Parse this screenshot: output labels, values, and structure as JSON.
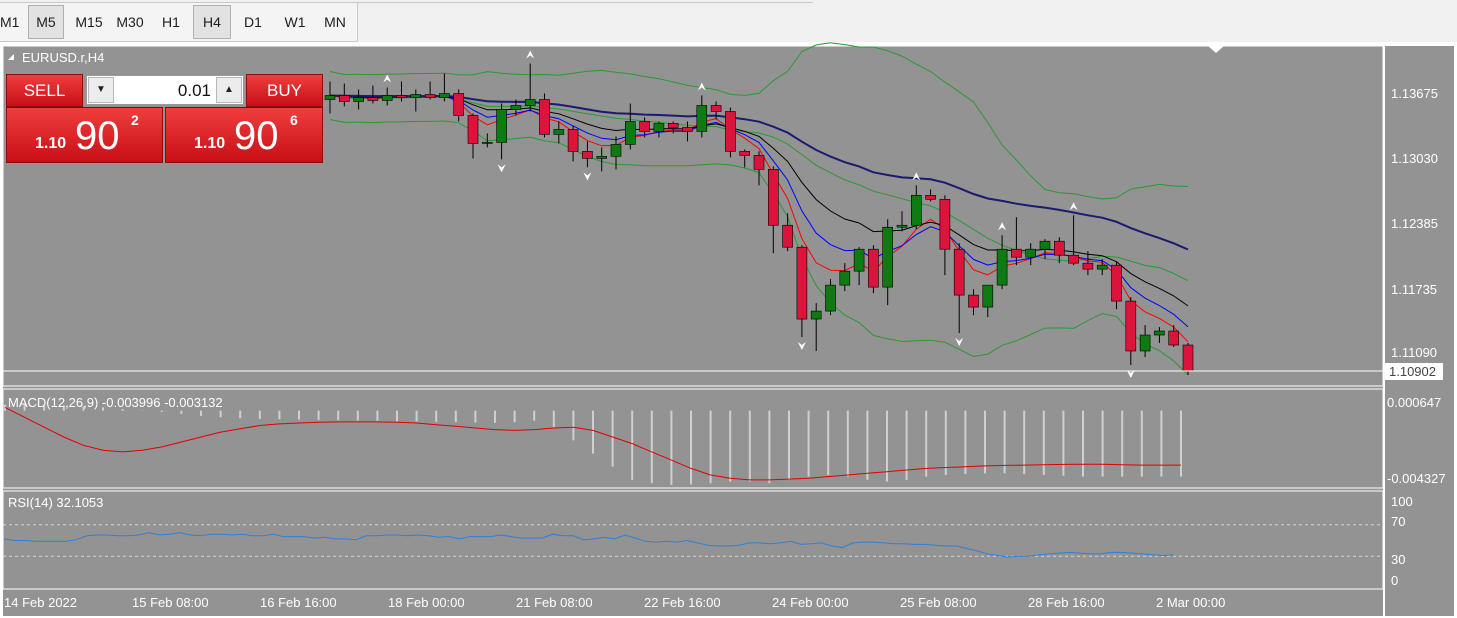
{
  "timeframes": [
    "M1",
    "M5",
    "M15",
    "M30",
    "H1",
    "H4",
    "D1",
    "W1",
    "MN"
  ],
  "active_timeframes": [
    "M5",
    "H4"
  ],
  "chart_title": "EURUSD.r,H4",
  "trade_panel": {
    "sell_label": "SELL",
    "buy_label": "BUY",
    "lot": "0.01",
    "sell_price": {
      "small": "1.10",
      "big": "90",
      "sup": "2"
    },
    "buy_price": {
      "small": "1.10",
      "big": "90",
      "sup": "6"
    }
  },
  "price_axis": {
    "ticks": [
      "1.13675",
      "1.13030",
      "1.12385",
      "1.11735",
      "1.11090"
    ],
    "current": "1.10902"
  },
  "macd": {
    "label": "MACD(12,26,9) -0.003996 -0.003132",
    "ticks": [
      "0.000647",
      "-0.004327"
    ]
  },
  "rsi": {
    "label": "RSI(14) 32.1053",
    "ticks": [
      "100",
      "70",
      "30",
      "0"
    ]
  },
  "time_axis": [
    "14 Feb 2022",
    "15 Feb 08:00",
    "16 Feb 16:00",
    "18 Feb 00:00",
    "21 Feb 08:00",
    "22 Feb 16:00",
    "24 Feb 00:00",
    "25 Feb 08:00",
    "28 Feb 16:00",
    "2 Mar 00:00"
  ],
  "colors": {
    "background": "#939393",
    "bull": "#0d7a12",
    "bear": "#dc143c",
    "ma_fast": "#ff0000",
    "ma_mid": "#0000ff",
    "ma_slow": "#000000",
    "ma_long": "#1a1a6e",
    "bollinger": "#2a9a32",
    "macd_signal": "#e00000",
    "rsi_line": "#2f7fd6"
  },
  "chart_data": {
    "type": "candlestick",
    "symbol": "EURUSD.r",
    "timeframe": "H4",
    "candles": [
      [
        1.1362,
        1.138,
        1.1348,
        1.1366
      ],
      [
        1.1366,
        1.1378,
        1.1355,
        1.136
      ],
      [
        1.136,
        1.1372,
        1.1352,
        1.1364
      ],
      [
        1.1364,
        1.1376,
        1.1358,
        1.1361
      ],
      [
        1.1361,
        1.1374,
        1.1356,
        1.1366
      ],
      [
        1.1366,
        1.138,
        1.136,
        1.1364
      ],
      [
        1.1364,
        1.1372,
        1.135,
        1.1367
      ],
      [
        1.1367,
        1.138,
        1.1362,
        1.1364
      ],
      [
        1.1364,
        1.1388,
        1.136,
        1.1368
      ],
      [
        1.1368,
        1.1372,
        1.134,
        1.1346
      ],
      [
        1.1346,
        1.1348,
        1.1303,
        1.1318
      ],
      [
        1.1318,
        1.1328,
        1.1314,
        1.1319
      ],
      [
        1.1319,
        1.1358,
        1.1302,
        1.1352
      ],
      [
        1.1352,
        1.1362,
        1.1346,
        1.1356
      ],
      [
        1.1356,
        1.1398,
        1.135,
        1.1362
      ],
      [
        1.1362,
        1.1368,
        1.1324,
        1.1327
      ],
      [
        1.1327,
        1.134,
        1.1318,
        1.1332
      ],
      [
        1.1332,
        1.1336,
        1.13,
        1.131
      ],
      [
        1.131,
        1.132,
        1.1294,
        1.1303
      ],
      [
        1.1303,
        1.1314,
        1.129,
        1.1305
      ],
      [
        1.1305,
        1.1325,
        1.1292,
        1.1317
      ],
      [
        1.1317,
        1.1358,
        1.1312,
        1.134
      ],
      [
        1.134,
        1.1344,
        1.1324,
        1.133
      ],
      [
        1.133,
        1.134,
        1.1324,
        1.1338
      ],
      [
        1.1338,
        1.134,
        1.1328,
        1.1334
      ],
      [
        1.1334,
        1.134,
        1.132,
        1.133
      ],
      [
        1.133,
        1.1366,
        1.1324,
        1.1356
      ],
      [
        1.1356,
        1.136,
        1.1342,
        1.135
      ],
      [
        1.135,
        1.1354,
        1.1304,
        1.131
      ],
      [
        1.131,
        1.1312,
        1.1294,
        1.1306
      ],
      [
        1.1306,
        1.131,
        1.1276,
        1.1292
      ],
      [
        1.1292,
        1.1295,
        1.1208,
        1.1236
      ],
      [
        1.1236,
        1.1248,
        1.121,
        1.1214
      ],
      [
        1.1214,
        1.1216,
        1.1124,
        1.1142
      ],
      [
        1.1142,
        1.1158,
        1.111,
        1.115
      ],
      [
        1.115,
        1.1182,
        1.1146,
        1.1176
      ],
      [
        1.1176,
        1.1198,
        1.117,
        1.119
      ],
      [
        1.119,
        1.1214,
        1.1176,
        1.1212
      ],
      [
        1.1212,
        1.1216,
        1.1168,
        1.1174
      ],
      [
        1.1174,
        1.1242,
        1.1156,
        1.1234
      ],
      [
        1.1234,
        1.125,
        1.123,
        1.1236
      ],
      [
        1.1236,
        1.1276,
        1.1232,
        1.1266
      ],
      [
        1.1266,
        1.1272,
        1.126,
        1.1262
      ],
      [
        1.1262,
        1.1266,
        1.1186,
        1.1212
      ],
      [
        1.1212,
        1.1218,
        1.1128,
        1.1166
      ],
      [
        1.1166,
        1.1172,
        1.1146,
        1.1154
      ],
      [
        1.1154,
        1.1176,
        1.1144,
        1.1176
      ],
      [
        1.1176,
        1.1226,
        1.1172,
        1.1212
      ],
      [
        1.1212,
        1.1244,
        1.1196,
        1.1204
      ],
      [
        1.1204,
        1.1218,
        1.1196,
        1.1212
      ],
      [
        1.1212,
        1.1222,
        1.1202,
        1.122
      ],
      [
        1.122,
        1.1224,
        1.1198,
        1.1206
      ],
      [
        1.1206,
        1.1246,
        1.1196,
        1.1198
      ],
      [
        1.1198,
        1.121,
        1.1186,
        1.1192
      ],
      [
        1.1192,
        1.1202,
        1.1186,
        1.1196
      ],
      [
        1.1196,
        1.12,
        1.1152,
        1.116
      ],
      [
        1.116,
        1.1164,
        1.1096,
        1.111
      ],
      [
        1.111,
        1.1136,
        1.1104,
        1.1126
      ],
      [
        1.1126,
        1.1134,
        1.1118,
        1.113
      ],
      [
        1.113,
        1.1136,
        1.1114,
        1.1116
      ],
      [
        1.1116,
        1.1118,
        1.1086,
        1.109
      ]
    ],
    "macd_histogram": [
      0.00036,
      0.0004,
      0.0003,
      0.00032,
      0.00026,
      0.0002,
      0.0001,
      2e-05,
      -8e-05,
      -0.0002,
      -0.00032,
      -0.0004,
      -0.00046,
      -0.0005,
      -0.00052,
      -0.00054,
      -0.00056,
      -0.00058,
      -0.0006,
      -0.00062,
      -0.00064,
      -0.00066,
      -0.00068,
      -0.0007,
      -0.00072,
      -0.00074,
      -0.0007,
      -0.0006,
      -0.001,
      -0.0018,
      -0.0026,
      -0.0034,
      -0.0042,
      -0.0044,
      -0.0045,
      -0.00448,
      -0.0044,
      -0.0043,
      -0.0043,
      -0.0044,
      -0.0042,
      -0.004,
      -0.0039,
      -0.004,
      -0.0042,
      -0.0043,
      -0.0042,
      -0.004,
      -0.0039,
      -0.00385,
      -0.0038,
      -0.0038,
      -0.00385,
      -0.0039,
      -0.00395,
      -0.004,
      -0.004,
      -0.004,
      -0.004,
      -0.004,
      -0.004
    ],
    "macd_signal": [
      0.0002,
      -0.0004,
      -0.001,
      -0.0016,
      -0.0021,
      -0.0024,
      -0.0025,
      -0.0024,
      -0.0022,
      -0.0019,
      -0.0016,
      -0.0013,
      -0.0011,
      -0.0009,
      -0.0008,
      -0.00075,
      -0.0007,
      -0.00068,
      -0.00068,
      -0.00068,
      -0.0007,
      -0.00075,
      -0.00085,
      -0.00095,
      -0.00105,
      -0.00115,
      -0.0012,
      -0.00115,
      -0.00105,
      -0.001,
      -0.0012,
      -0.0016,
      -0.002,
      -0.0025,
      -0.003,
      -0.0035,
      -0.0039,
      -0.0041,
      -0.0042,
      -0.0042,
      -0.00415,
      -0.0041,
      -0.004,
      -0.0039,
      -0.0038,
      -0.0037,
      -0.0036,
      -0.0035,
      -0.00345,
      -0.0034,
      -0.00335,
      -0.00332,
      -0.0033,
      -0.00328,
      -0.00326,
      -0.00325,
      -0.00325,
      -0.00328,
      -0.0033,
      -0.0033,
      -0.0033
    ],
    "rsi": [
      52,
      50,
      50,
      49,
      49,
      49,
      49,
      51,
      56,
      57,
      57,
      56,
      56,
      57,
      60,
      57,
      58,
      60,
      57,
      56,
      58,
      58,
      57,
      58,
      56,
      56,
      58,
      55,
      55,
      55,
      53,
      54,
      52,
      52,
      51,
      56,
      56,
      57,
      57,
      56,
      57,
      56,
      54,
      55,
      52,
      55,
      55,
      55,
      57,
      55,
      53,
      53,
      53,
      58,
      56,
      56,
      51,
      52,
      54,
      52,
      57,
      53,
      49,
      48,
      49,
      48,
      50,
      47,
      44,
      43,
      43,
      44,
      47,
      47,
      46,
      47,
      49,
      45,
      46,
      47,
      43,
      41,
      47,
      48,
      48,
      47,
      46,
      46,
      45,
      45,
      44,
      43,
      43,
      40,
      37,
      33,
      31,
      29,
      30,
      30,
      32,
      33,
      34,
      35,
      34,
      33,
      33,
      35,
      35,
      34,
      33,
      32,
      31,
      32
    ]
  }
}
